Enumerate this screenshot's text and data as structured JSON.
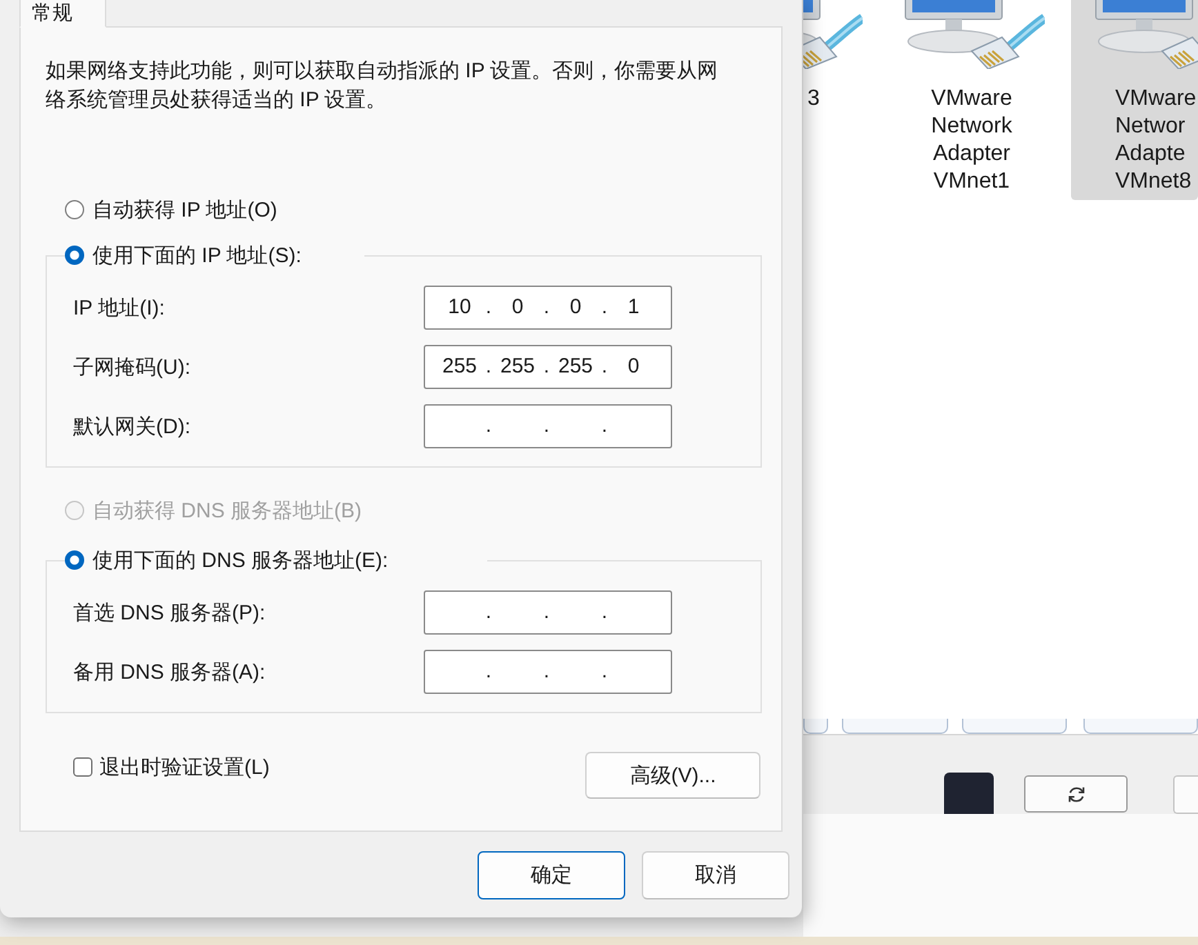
{
  "tabs": [
    {
      "label": "常规",
      "selected": true
    }
  ],
  "description": "如果网络支持此功能，则可以获取自动指派的 IP 设置。否则，你需要从网络系统管理员处获得适当的 IP 设置。",
  "ip_mode": {
    "options": [
      {
        "label": "自动获得 IP 地址(O)",
        "selected": false,
        "disabled": false
      },
      {
        "label": "使用下面的 IP 地址(S):",
        "selected": true,
        "disabled": false
      }
    ],
    "fields": [
      {
        "label": "IP 地址(I):",
        "value": "10 . 0 . 0 . 1"
      },
      {
        "label": "子网掩码(U):",
        "value": "255 . 255 . 255 . 0"
      },
      {
        "label": "默认网关(D):",
        "value": ". . ."
      }
    ]
  },
  "dns_mode": {
    "options": [
      {
        "label": "自动获得 DNS 服务器地址(B)",
        "selected": false,
        "disabled": true
      },
      {
        "label": "使用下面的 DNS 服务器地址(E):",
        "selected": true,
        "disabled": false
      }
    ],
    "fields": [
      {
        "label": "首选 DNS 服务器(P):",
        "value": ". . ."
      },
      {
        "label": "备用 DNS 服务器(A):",
        "value": ". . ."
      }
    ]
  },
  "validate_on_exit": {
    "label": "退出时验证设置(L)",
    "checked": false
  },
  "advanced_button": {
    "label": "高级(V)..."
  },
  "footer_buttons": [
    {
      "label": "确定",
      "default": true
    },
    {
      "label": "取消",
      "default": false
    }
  ],
  "background_window": {
    "adapters": [
      {
        "label": "3",
        "selected": false
      },
      {
        "label": "VMware Network Adapter VMnet1",
        "selected": false
      },
      {
        "label": "VMware Networ Adapte VMnet8",
        "selected": true
      }
    ]
  }
}
